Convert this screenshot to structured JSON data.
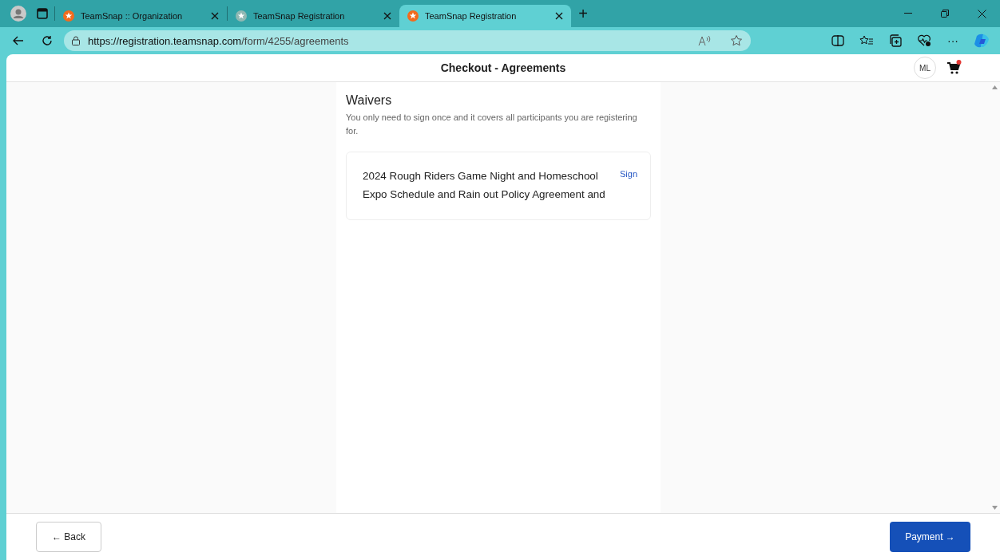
{
  "browser": {
    "tabs": [
      {
        "title": "TeamSnap :: Organization",
        "selected": false,
        "dimmed": false
      },
      {
        "title": "TeamSnap Registration",
        "selected": false,
        "dimmed": true
      },
      {
        "title": "TeamSnap Registration",
        "selected": true,
        "dimmed": false
      }
    ],
    "new_tab": "+",
    "address": {
      "host": "https://registration.teamsnap.com",
      "path": "/form/4255/agreements"
    },
    "more": "···"
  },
  "header": {
    "title": "Checkout - Agreements",
    "avatar": "ML",
    "cart_badge": true
  },
  "waivers": {
    "heading": "Waivers",
    "note": "You only need to sign once and it covers all participants you are registering for.",
    "items": [
      {
        "title": "2024 Rough Riders Game Night and Homeschool Expo Schedule and Rain out Policy Agreement and",
        "action": "Sign"
      }
    ]
  },
  "footer": {
    "back": "← Back",
    "next": "Payment →"
  }
}
